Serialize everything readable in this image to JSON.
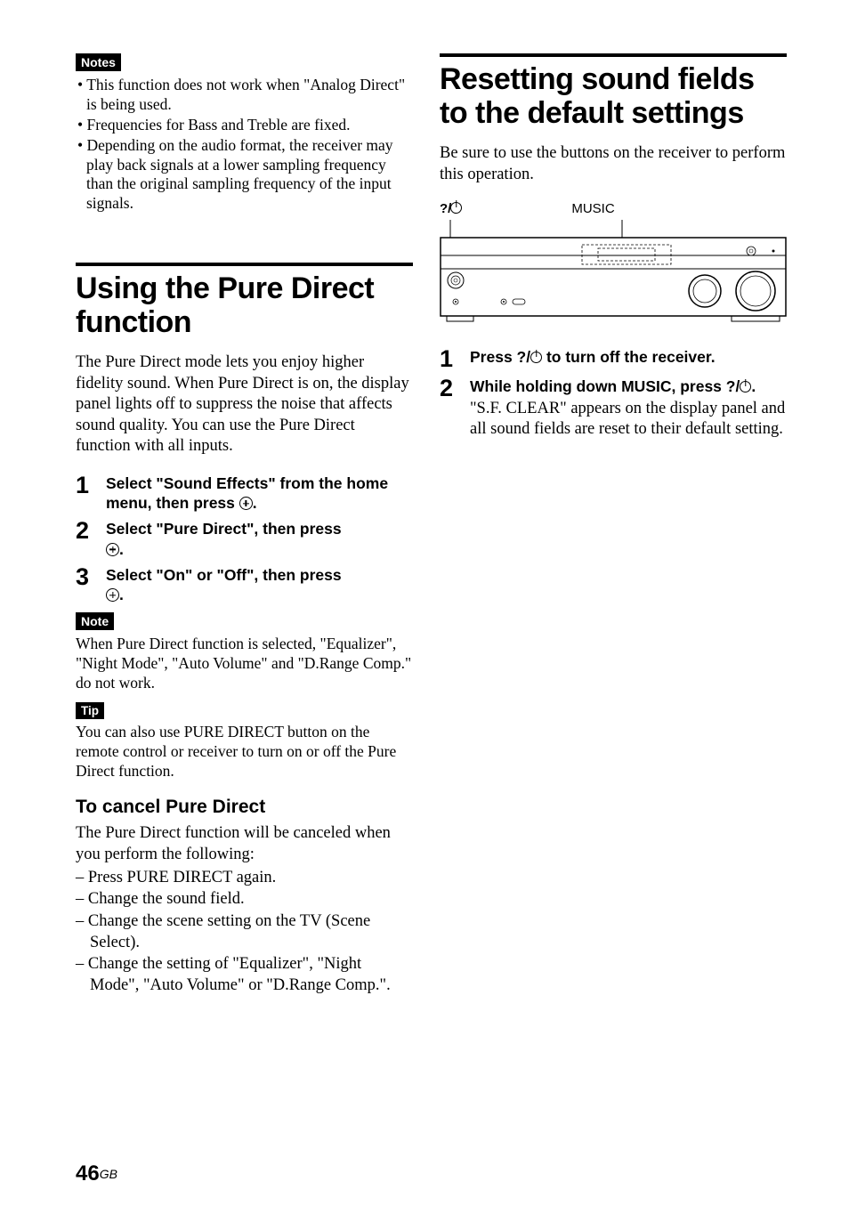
{
  "left": {
    "notes_label": "Notes",
    "notes": [
      "This function does not work when \"Analog Direct\" is being used.",
      "Frequencies for Bass and Treble are fixed.",
      "Depending on the audio format, the receiver may play back signals at a lower sampling frequency than the original sampling frequency of the input signals."
    ],
    "title": "Using the Pure Direct function",
    "intro": "The Pure Direct mode lets you enjoy higher fidelity sound. When Pure Direct is on, the display panel lights off to suppress the noise that affects sound quality. You can use the Pure Direct function with all inputs.",
    "steps": [
      {
        "num": "1",
        "text_pre": "Select \"Sound Effects\" from the home menu, then press ",
        "text_post": "."
      },
      {
        "num": "2",
        "text_pre": "Select \"Pure Direct\", then press ",
        "text_post": "."
      },
      {
        "num": "3",
        "text_pre": "Select \"On\" or \"Off\",  then press ",
        "text_post": "."
      }
    ],
    "note_label": "Note",
    "note_text": "When Pure Direct function is selected, \"Equalizer\", \"Night Mode\", \"Auto Volume\" and \"D.Range Comp.\" do not work.",
    "tip_label": "Tip",
    "tip_text": "You can also use PURE DIRECT button on the remote control or receiver to turn on or off the Pure Direct function.",
    "sub_heading": "To cancel Pure Direct",
    "cancel_intro": "The Pure Direct function will be canceled when you perform the following:",
    "cancel_items": [
      "Press PURE DIRECT again.",
      "Change the sound field.",
      "Change the scene setting on the TV (Scene Select).",
      "Change the setting of \"Equalizer\", \"Night Mode\", \"Auto Volume\" or \"D.Range Comp.\"."
    ]
  },
  "right": {
    "title": "Resetting sound fields to the default settings",
    "intro": "Be sure to use the buttons on the receiver to perform this operation.",
    "diagram": {
      "power_label": "?/",
      "music_label": "MUSIC"
    },
    "steps": [
      {
        "num": "1",
        "text_pre": "Press ?/",
        "text_post": " to turn off the receiver."
      },
      {
        "num": "2",
        "text_pre": "While holding down MUSIC, press ?/",
        "text_post": ".",
        "sub_text": "\"S.F. CLEAR\" appears on the display panel and all sound fields are reset to their default setting."
      }
    ]
  },
  "footer": {
    "page_num": "46",
    "region": "GB"
  }
}
